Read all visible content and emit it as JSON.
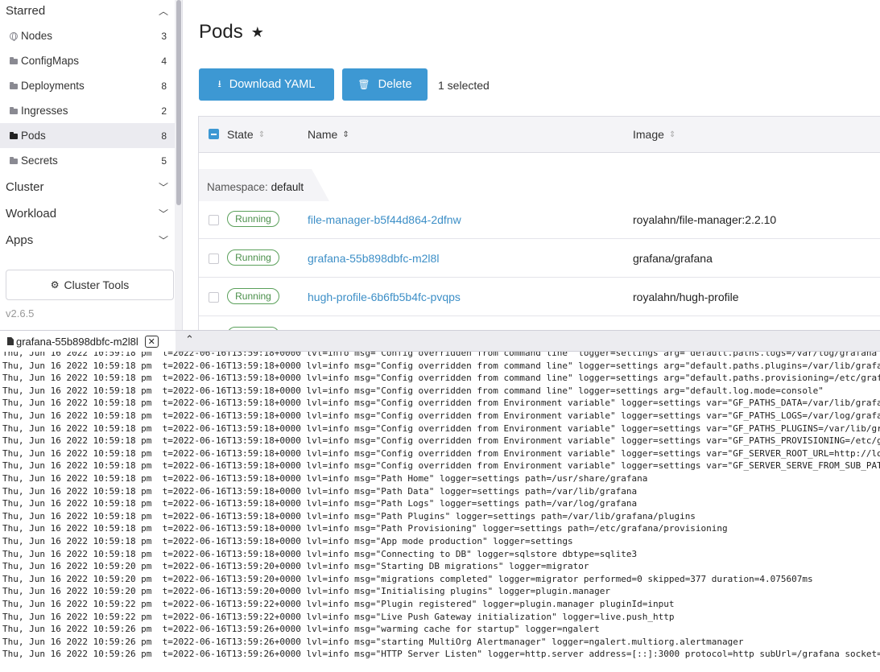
{
  "sidebar": {
    "starred": {
      "label": "Starred",
      "chevron": "chevron-up-icon"
    },
    "items": [
      {
        "label": "Nodes",
        "count": "3",
        "icon": "globe-icon"
      },
      {
        "label": "ConfigMaps",
        "count": "4",
        "icon": "folder-icon"
      },
      {
        "label": "Deployments",
        "count": "8",
        "icon": "folder-icon"
      },
      {
        "label": "Ingresses",
        "count": "2",
        "icon": "folder-icon"
      },
      {
        "label": "Pods",
        "count": "8",
        "icon": "folder-icon",
        "active": true
      },
      {
        "label": "Secrets",
        "count": "5",
        "icon": "folder-icon"
      }
    ],
    "groups": [
      {
        "label": "Cluster"
      },
      {
        "label": "Workload"
      },
      {
        "label": "Apps"
      }
    ],
    "cluster_tools": "Cluster Tools",
    "version": "v2.6.5"
  },
  "main": {
    "title": "Pods",
    "download_button": "Download YAML",
    "delete_button": "Delete",
    "selected_text": "1 selected",
    "columns": {
      "state": "State",
      "name": "Name",
      "image": "Image"
    },
    "namespace_label": "Namespace:",
    "namespace_value": "default",
    "rows": [
      {
        "state": "Running",
        "name": "file-manager-b5f44d864-2dfnw",
        "image": "royalahn/file-manager:2.2.10"
      },
      {
        "state": "Running",
        "name": "grafana-55b898dbfc-m2l8l",
        "image": "grafana/grafana"
      },
      {
        "state": "Running",
        "name": "hugh-profile-6b6fb5b4fc-pvqps",
        "image": "royalahn/hugh-profile"
      }
    ]
  },
  "log_panel": {
    "tab_title": "grafana-55b898dbfc-m2l8l",
    "close_symbol": "✕",
    "lines": [
      "Thu, Jun 16 2022 10:59:18 pm  t=2022-06-16T13:59:18+0000 lvl=info msg=\"Config overridden from command line\" logger=settings arg=\"default.paths.logs=/var/log/grafana",
      "Thu, Jun 16 2022 10:59:18 pm  t=2022-06-16T13:59:18+0000 lvl=info msg=\"Config overridden from command line\" logger=settings arg=\"default.paths.plugins=/var/lib/grafa",
      "Thu, Jun 16 2022 10:59:18 pm  t=2022-06-16T13:59:18+0000 lvl=info msg=\"Config overridden from command line\" logger=settings arg=\"default.paths.provisioning=/etc/graf",
      "Thu, Jun 16 2022 10:59:18 pm  t=2022-06-16T13:59:18+0000 lvl=info msg=\"Config overridden from command line\" logger=settings arg=\"default.log.mode=console\"",
      "Thu, Jun 16 2022 10:59:18 pm  t=2022-06-16T13:59:18+0000 lvl=info msg=\"Config overridden from Environment variable\" logger=settings var=\"GF_PATHS_DATA=/var/lib/grafa",
      "Thu, Jun 16 2022 10:59:18 pm  t=2022-06-16T13:59:18+0000 lvl=info msg=\"Config overridden from Environment variable\" logger=settings var=\"GF_PATHS_LOGS=/var/log/grafa",
      "Thu, Jun 16 2022 10:59:18 pm  t=2022-06-16T13:59:18+0000 lvl=info msg=\"Config overridden from Environment variable\" logger=settings var=\"GF_PATHS_PLUGINS=/var/lib/gr",
      "Thu, Jun 16 2022 10:59:18 pm  t=2022-06-16T13:59:18+0000 lvl=info msg=\"Config overridden from Environment variable\" logger=settings var=\"GF_PATHS_PROVISIONING=/etc/g",
      "Thu, Jun 16 2022 10:59:18 pm  t=2022-06-16T13:59:18+0000 lvl=info msg=\"Config overridden from Environment variable\" logger=settings var=\"GF_SERVER_ROOT_URL=http://lo",
      "Thu, Jun 16 2022 10:59:18 pm  t=2022-06-16T13:59:18+0000 lvl=info msg=\"Config overridden from Environment variable\" logger=settings var=\"GF_SERVER_SERVE_FROM_SUB_PAT",
      "Thu, Jun 16 2022 10:59:18 pm  t=2022-06-16T13:59:18+0000 lvl=info msg=\"Path Home\" logger=settings path=/usr/share/grafana",
      "Thu, Jun 16 2022 10:59:18 pm  t=2022-06-16T13:59:18+0000 lvl=info msg=\"Path Data\" logger=settings path=/var/lib/grafana",
      "Thu, Jun 16 2022 10:59:18 pm  t=2022-06-16T13:59:18+0000 lvl=info msg=\"Path Logs\" logger=settings path=/var/log/grafana",
      "Thu, Jun 16 2022 10:59:18 pm  t=2022-06-16T13:59:18+0000 lvl=info msg=\"Path Plugins\" logger=settings path=/var/lib/grafana/plugins",
      "Thu, Jun 16 2022 10:59:18 pm  t=2022-06-16T13:59:18+0000 lvl=info msg=\"Path Provisioning\" logger=settings path=/etc/grafana/provisioning",
      "Thu, Jun 16 2022 10:59:18 pm  t=2022-06-16T13:59:18+0000 lvl=info msg=\"App mode production\" logger=settings",
      "Thu, Jun 16 2022 10:59:18 pm  t=2022-06-16T13:59:18+0000 lvl=info msg=\"Connecting to DB\" logger=sqlstore dbtype=sqlite3",
      "Thu, Jun 16 2022 10:59:20 pm  t=2022-06-16T13:59:20+0000 lvl=info msg=\"Starting DB migrations\" logger=migrator",
      "Thu, Jun 16 2022 10:59:20 pm  t=2022-06-16T13:59:20+0000 lvl=info msg=\"migrations completed\" logger=migrator performed=0 skipped=377 duration=4.075607ms",
      "Thu, Jun 16 2022 10:59:20 pm  t=2022-06-16T13:59:20+0000 lvl=info msg=\"Initialising plugins\" logger=plugin.manager",
      "Thu, Jun 16 2022 10:59:22 pm  t=2022-06-16T13:59:22+0000 lvl=info msg=\"Plugin registered\" logger=plugin.manager pluginId=input",
      "Thu, Jun 16 2022 10:59:22 pm  t=2022-06-16T13:59:22+0000 lvl=info msg=\"Live Push Gateway initialization\" logger=live.push_http",
      "Thu, Jun 16 2022 10:59:26 pm  t=2022-06-16T13:59:26+0000 lvl=info msg=\"warming cache for startup\" logger=ngalert",
      "Thu, Jun 16 2022 10:59:26 pm  t=2022-06-16T13:59:26+0000 lvl=info msg=\"starting MultiOrg Alertmanager\" logger=ngalert.multiorg.alertmanager",
      "Thu, Jun 16 2022 10:59:26 pm  t=2022-06-16T13:59:26+0000 lvl=info msg=\"HTTP Server Listen\" logger=http.server address=[::]:3000 protocol=http subUrl=/grafana socket="
    ]
  },
  "colors": {
    "accent": "#3d98d3",
    "link": "#3d8fc7",
    "running": "#4a8f4a"
  }
}
